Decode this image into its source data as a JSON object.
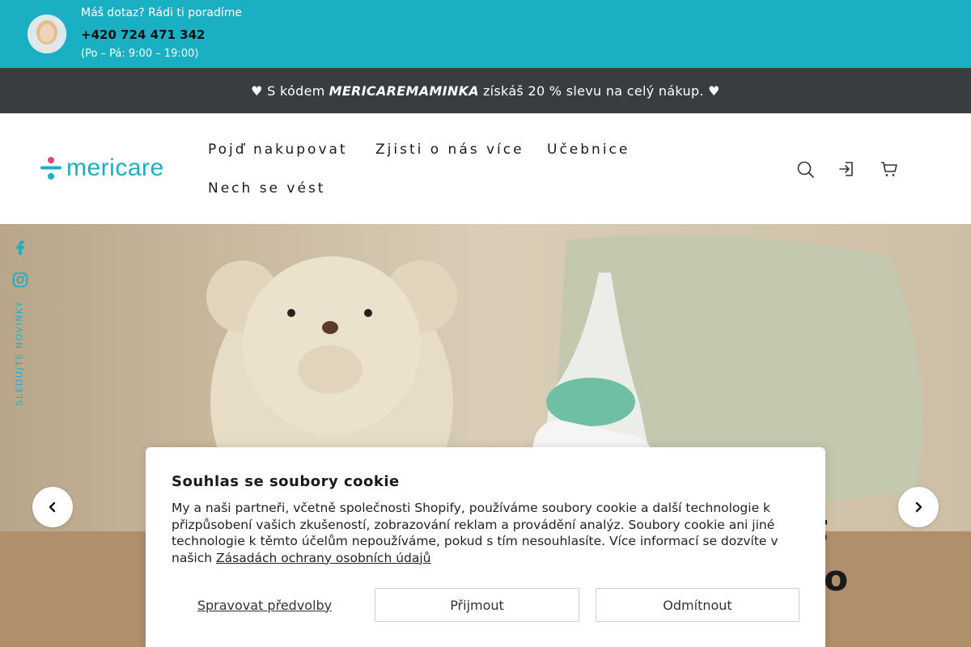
{
  "topbar": {
    "question": "Máš dotaz? Rádi ti poradíme",
    "phone": "+420 724 471 342",
    "hours": "(Po – Pá: 9:00 – 19:00)"
  },
  "promo": {
    "prefix": "♥ S kódem",
    "code": "MERICAREMAMINKA",
    "suffix": "získáš 20 % slevu na celý nákup. ♥"
  },
  "header": {
    "logo_text": "mericare",
    "nav": [
      "Pojď nakupovat",
      "Zjisti o nás více",
      "Učebnice",
      "Nech se vést"
    ],
    "icons": [
      "search-icon",
      "account-icon",
      "cart-icon"
    ]
  },
  "hero": {
    "follow_label": "SLEDUJTE NOVINKY",
    "partial_text_1": "t",
    "partial_text_2": "o"
  },
  "cookie": {
    "title": "Souhlas se soubory cookie",
    "body": "My a naši partneři, včetně společnosti Shopify, používáme soubory cookie a další technologie k přizpůsobení vašich zkušeností, zobrazování reklam a provádění analýz. Soubory cookie ani jiné technologie k těmto účelům nepoužíváme, pokud s tím nesouhlasíte. Více informací se dozvíte v našich",
    "link": "Zásadách ochrany osobních údajů",
    "manage_label": "Spravovat předvolby",
    "accept_label": "Přijmout",
    "decline_label": "Odmítnout"
  },
  "colors": {
    "accent": "#1bafc3",
    "promo_bg": "#3a3d3f",
    "logo_pink": "#e0457b"
  }
}
